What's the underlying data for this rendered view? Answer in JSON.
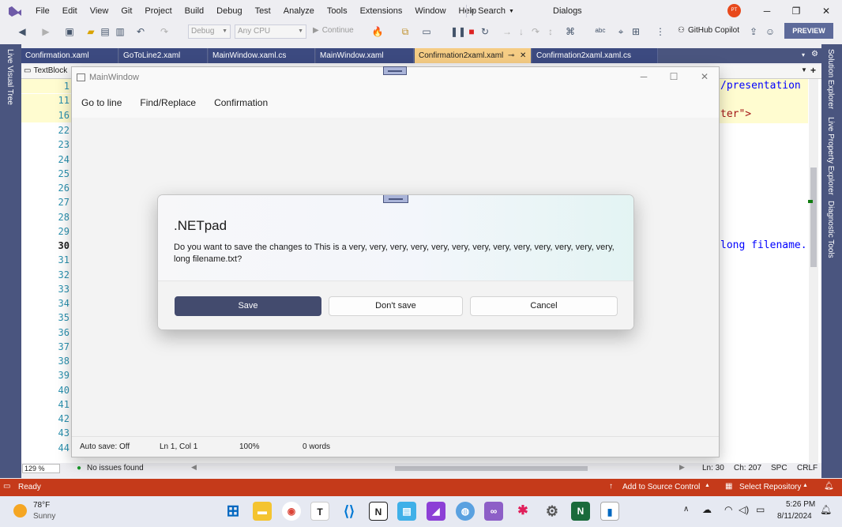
{
  "menubar": {
    "items": [
      "File",
      "Edit",
      "View",
      "Git",
      "Project",
      "Build",
      "Debug",
      "Test",
      "Analyze",
      "Tools",
      "Extensions",
      "Window",
      "Help"
    ],
    "search_label": "Search",
    "solution_name": "Dialogs",
    "avatar_initials": "PT"
  },
  "toolbar": {
    "config_combo": "Debug",
    "platform_combo": "Any CPU",
    "continue_label": "Continue",
    "copilot_label": "GitHub Copilot",
    "preview_label": "PREVIEW"
  },
  "side_panels": {
    "left": "Live Visual Tree",
    "right": [
      "Solution Explorer",
      "Live Property Explorer",
      "Diagnostic Tools"
    ]
  },
  "doc_tabs": [
    {
      "label": "Confirmation.xaml"
    },
    {
      "label": "GoToLine2.xaml"
    },
    {
      "label": "MainWindow.xaml.cs"
    },
    {
      "label": "MainWindow.xaml"
    },
    {
      "label": "Confirmation2xaml.xaml",
      "active": true
    },
    {
      "label": "Confirmation2xaml.xaml.cs"
    }
  ],
  "editor": {
    "element_label": "TextBlock",
    "sticky_lines": [
      "1",
      "11",
      "16"
    ],
    "line_numbers": [
      "22",
      "23",
      "24",
      "25",
      "26",
      "27",
      "28",
      "29",
      "30",
      "31",
      "32",
      "33",
      "34",
      "35",
      "36",
      "37",
      "38",
      "39",
      "40",
      "41",
      "42",
      "43",
      "44"
    ],
    "current_line": "30",
    "code_fragments": [
      "/presentation",
      "ter\">",
      "long filename."
    ],
    "zoom": "129 %",
    "issues": "No issues found",
    "ln": "Ln: 30",
    "ch": "Ch: 207",
    "spc": "SPC",
    "crlf": "CRLF"
  },
  "status_bar": {
    "ready": "Ready",
    "source_control": "Add to Source Control",
    "select_repo": "Select Repository"
  },
  "main_window": {
    "title": "MainWindow",
    "menu": [
      "Go to line",
      "Find/Replace",
      "Confirmation"
    ],
    "status": {
      "autosave": "Auto save: Off",
      "position": "Ln 1, Col 1",
      "zoom": "100%",
      "words": "0 words"
    }
  },
  "dialog": {
    "title": ".NETpad",
    "message": "Do you want to save the changes to This is a very, very, very, very, very, very, very, very, very, very, very, very, very, long filename.txt?",
    "save_label": "Save",
    "dont_save_label": "Don't save",
    "cancel_label": "Cancel"
  },
  "taskbar": {
    "weather_temp": "78°F",
    "weather_desc": "Sunny",
    "time": "5:26 PM",
    "date": "8/11/2024"
  },
  "colors": {
    "vs_accent": "#4a557f",
    "status_bar": "#c53a1a",
    "active_tab": "#f5cc84",
    "dialog_primary": "#434b6e"
  }
}
